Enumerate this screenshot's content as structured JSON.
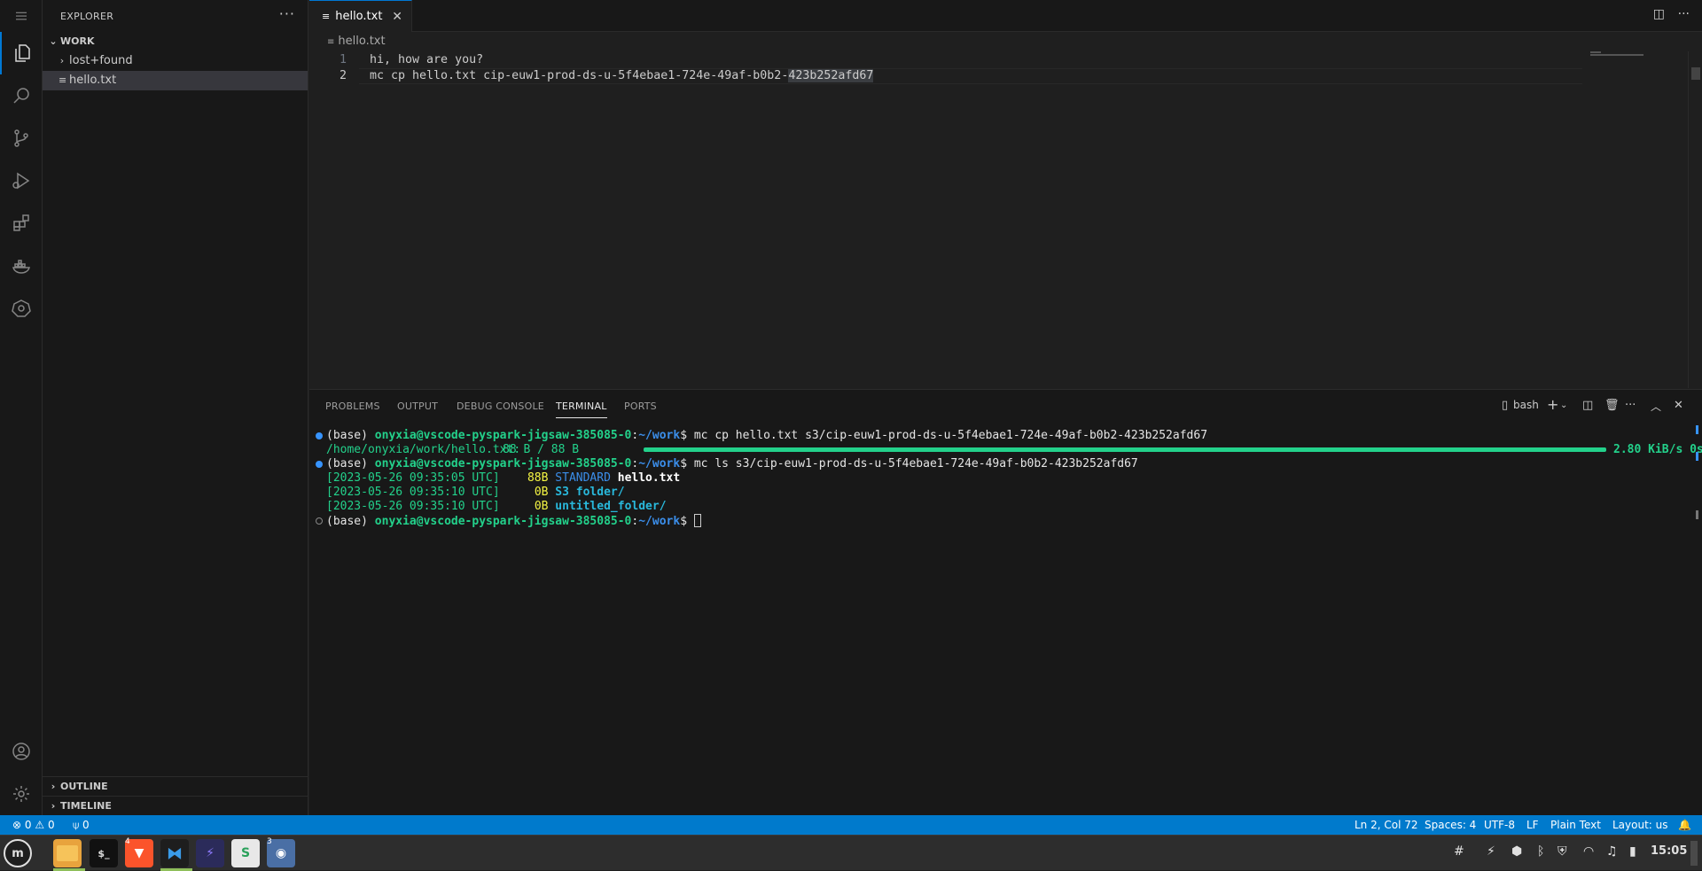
{
  "sidebar": {
    "title": "EXPLORER",
    "more": "···",
    "workspace": "WORK",
    "items": [
      {
        "label": "lost+found",
        "type": "folder"
      },
      {
        "label": "hello.txt",
        "type": "file"
      }
    ],
    "outline": "OUTLINE",
    "timeline": "TIMELINE"
  },
  "editor": {
    "tab_label": "hello.txt",
    "breadcrumb": "hello.txt",
    "lines": [
      {
        "num": "1",
        "text": "hi, how are you?"
      },
      {
        "num": "2",
        "text_before": "mc cp hello.txt cip-euw1-prod-ds-u-5f4ebae1-724e-49af-b0b2-",
        "text_selected": "423b252afd67"
      }
    ]
  },
  "panel": {
    "tabs": [
      "PROBLEMS",
      "OUTPUT",
      "DEBUG CONSOLE",
      "TERMINAL",
      "PORTS"
    ],
    "active_tab": "TERMINAL",
    "shell": "bash",
    "terminal": {
      "prompt_env": "(base) ",
      "prompt_user": "onyxia@vscode-pyspark-jigsaw-385085-0",
      "prompt_colon": ":",
      "prompt_path": "~/work",
      "prompt_dollar": "$ ",
      "cmd1": "mc cp hello.txt s3/cip-euw1-prod-ds-u-5f4ebae1-724e-49af-b0b2-423b252afd67",
      "progress_file": "/home/onyxia/work/hello.txt:",
      "progress_size": "88 B / 88 B",
      "progress_rate": "2.80 KiB/s 0s",
      "progress_fraction": 1.0,
      "cmd2": "mc ls s3/cip-euw1-prod-ds-u-5f4ebae1-724e-49af-b0b2-423b252afd67",
      "ls": [
        {
          "date": "[2023-05-26 09:35:05 UTC]",
          "size": "88B",
          "class": "STANDARD",
          "name": "hello.txt"
        },
        {
          "date": "[2023-05-26 09:35:10 UTC]",
          "size": "0B",
          "class": "",
          "name": "S3 folder/"
        },
        {
          "date": "[2023-05-26 09:35:10 UTC]",
          "size": "0B",
          "class": "",
          "name": "untitled_folder/"
        }
      ]
    }
  },
  "status": {
    "errors": "0",
    "warnings": "0",
    "ports": "0",
    "position": "Ln 2, Col 72",
    "spaces": "Spaces: 4",
    "encoding": "UTF-8",
    "eol": "LF",
    "language": "Plain Text",
    "layout": "Layout: us"
  },
  "taskbar": {
    "clock": "15:05",
    "badges": {
      "brave": "4",
      "screenshot": "3"
    }
  },
  "colors": {
    "accent": "#007acc",
    "terminal_green": "#23d18b",
    "terminal_blue": "#3b8eea",
    "terminal_yellow": "#f5f543"
  }
}
